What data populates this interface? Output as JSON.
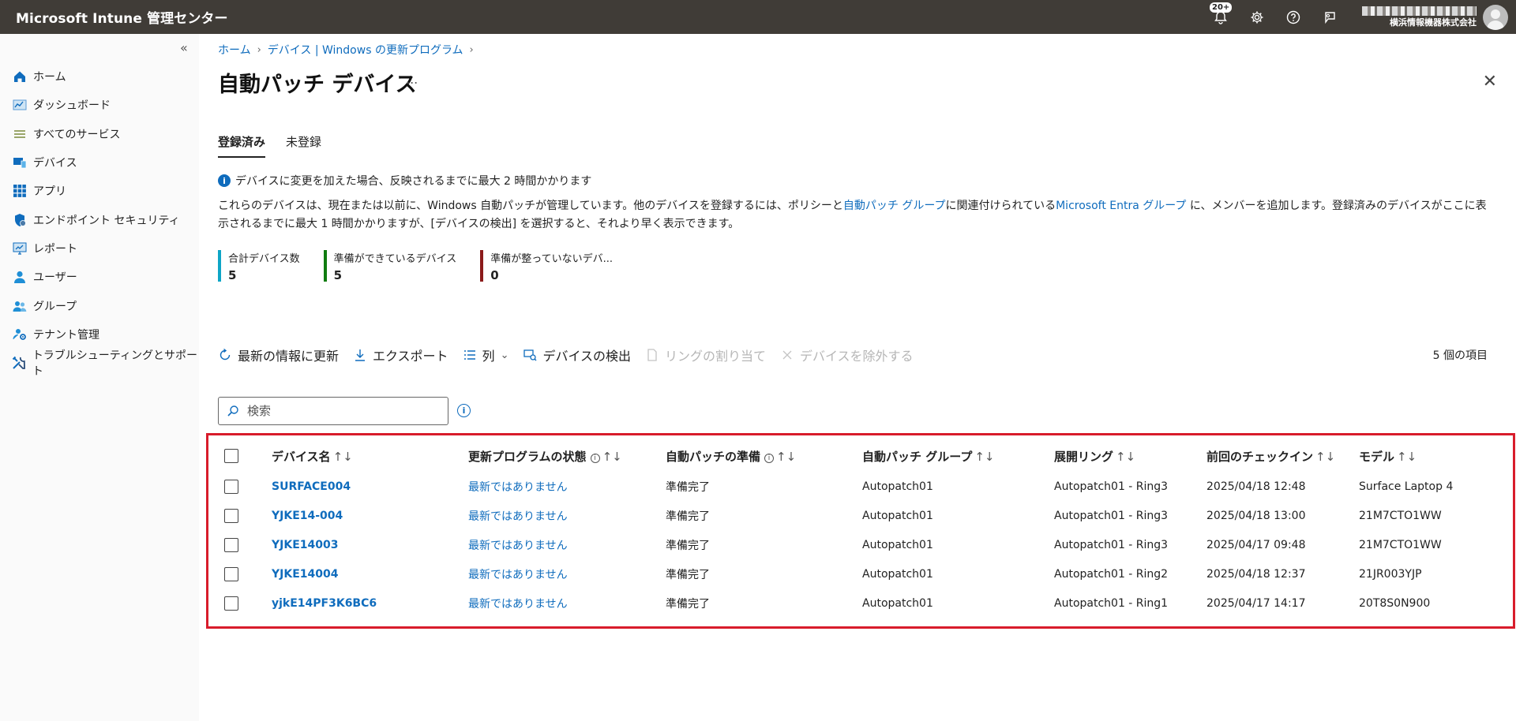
{
  "app": {
    "title": "Microsoft Intune 管理センター",
    "notification_badge": "20+",
    "org_name": "横浜情報機器株式会社"
  },
  "sidebar": {
    "items": [
      {
        "label": "ホーム",
        "icon": "home-icon"
      },
      {
        "label": "ダッシュボード",
        "icon": "dashboard-icon"
      },
      {
        "label": "すべてのサービス",
        "icon": "list-icon"
      },
      {
        "label": "デバイス",
        "icon": "devices-icon"
      },
      {
        "label": "アプリ",
        "icon": "apps-grid-icon"
      },
      {
        "label": "エンドポイント セキュリティ",
        "icon": "shield-icon"
      },
      {
        "label": "レポート",
        "icon": "report-icon"
      },
      {
        "label": "ユーザー",
        "icon": "user-icon"
      },
      {
        "label": "グループ",
        "icon": "group-icon"
      },
      {
        "label": "テナント管理",
        "icon": "tenant-icon"
      },
      {
        "label": "トラブルシューティングとサポート",
        "icon": "tools-icon"
      }
    ]
  },
  "breadcrumb": [
    "ホーム",
    "デバイス | Windows の更新プログラム"
  ],
  "page": {
    "title": "自動パッチ デバイス",
    "more": "...",
    "tabs": [
      "登録済み",
      "未登録"
    ],
    "info_text": "デバイスに変更を加えた場合、反映されるまでに最大 2 時間かかります",
    "desc_1": "これらのデバイスは、現在または以前に、Windows 自動パッチが管理しています。他のデバイスを登録するには、ポリシーと",
    "desc_link1": "自動パッチ グループ",
    "desc_2": "に関連付けられている",
    "desc_link2": "Microsoft Entra グループ",
    "desc_3": " に、メンバーを追加します。登録済みのデバイスがここに表示されるまでに最大 1 時間かかりますが、[デバイスの検出] を選択すると、それより早く表示できます。"
  },
  "stats": [
    {
      "label": "合計デバイス数",
      "value": "5",
      "color": "#0ea5c6"
    },
    {
      "label": "準備ができているデバイス",
      "value": "5",
      "color": "#107c10"
    },
    {
      "label": "準備が整っていないデバ...",
      "value": "0",
      "color": "#8b1a1a"
    }
  ],
  "toolbar": {
    "refresh": "最新の情報に更新",
    "export": "エクスポート",
    "columns": "列",
    "discover": "デバイスの検出",
    "assign_ring": "リングの割り当て",
    "exclude": "デバイスを除外する",
    "count": "5 個の項目"
  },
  "search": {
    "placeholder": "検索"
  },
  "table": {
    "headers": {
      "name": "デバイス名",
      "update_status": "更新プログラムの状態",
      "readiness": "自動パッチの準備",
      "group": "自動パッチ グループ",
      "ring": "展開リング",
      "checkin": "前回のチェックイン",
      "model": "モデル"
    },
    "rows": [
      {
        "name": "SURFACE004",
        "status": "最新ではありません",
        "ready": "準備完了",
        "group": "Autopatch01",
        "ring": "Autopatch01 - Ring3",
        "checkin": "2025/04/18 12:48",
        "model": "Surface Laptop 4"
      },
      {
        "name": "YJKE14-004",
        "status": "最新ではありません",
        "ready": "準備完了",
        "group": "Autopatch01",
        "ring": "Autopatch01 - Ring3",
        "checkin": "2025/04/18 13:00",
        "model": "21M7CTO1WW"
      },
      {
        "name": "YJKE14003",
        "status": "最新ではありません",
        "ready": "準備完了",
        "group": "Autopatch01",
        "ring": "Autopatch01 - Ring3",
        "checkin": "2025/04/17 09:48",
        "model": "21M7CTO1WW"
      },
      {
        "name": "YJKE14004",
        "status": "最新ではありません",
        "ready": "準備完了",
        "group": "Autopatch01",
        "ring": "Autopatch01 - Ring2",
        "checkin": "2025/04/18 12:37",
        "model": "21JR003YJP"
      },
      {
        "name": "yjkE14PF3K6BC6",
        "status": "最新ではありません",
        "ready": "準備完了",
        "group": "Autopatch01",
        "ring": "Autopatch01 - Ring1",
        "checkin": "2025/04/17 14:17",
        "model": "20T8S0N900"
      }
    ]
  },
  "colors": {
    "topbar": "#403c37",
    "link": "#0f6cbd",
    "highlight": "#d81c2b"
  }
}
